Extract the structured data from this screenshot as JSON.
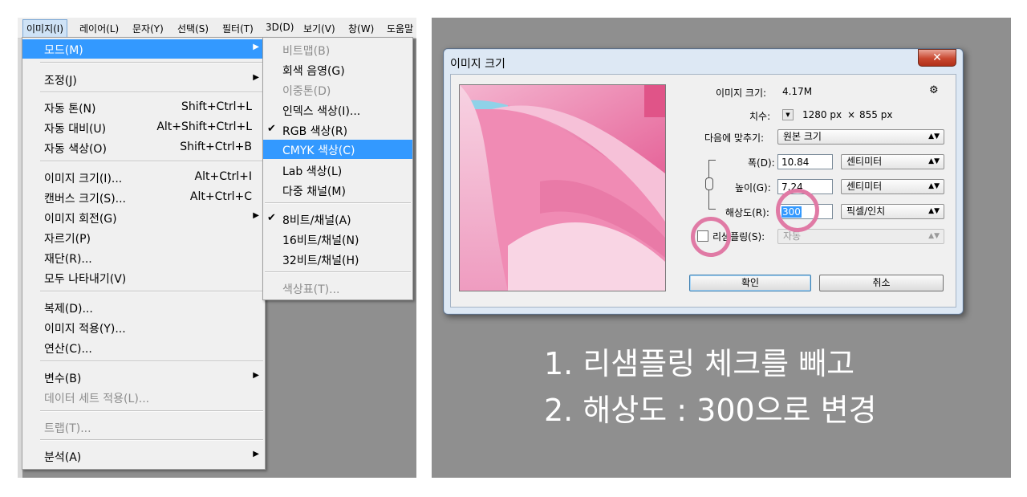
{
  "menubar": {
    "items": [
      "이미지(I)",
      "레이어(L)",
      "문자(Y)",
      "선택(S)",
      "필터(T)",
      "3D(D)",
      "보기(V)",
      "창(W)",
      "도움말"
    ]
  },
  "image_menu": {
    "items": [
      {
        "label": "모드(M)",
        "shortcut": "",
        "submenu": true
      },
      {
        "label": "조정(J)",
        "shortcut": "",
        "submenu": true
      },
      {
        "label": "자동 톤(N)",
        "shortcut": "Shift+Ctrl+L"
      },
      {
        "label": "자동 대비(U)",
        "shortcut": "Alt+Shift+Ctrl+L"
      },
      {
        "label": "자동 색상(O)",
        "shortcut": "Shift+Ctrl+B"
      },
      {
        "label": "이미지 크기(I)...",
        "shortcut": "Alt+Ctrl+I"
      },
      {
        "label": "캔버스 크기(S)...",
        "shortcut": "Alt+Ctrl+C"
      },
      {
        "label": "이미지 회전(G)",
        "shortcut": "",
        "submenu": true
      },
      {
        "label": "자르기(P)",
        "shortcut": ""
      },
      {
        "label": "재단(R)...",
        "shortcut": ""
      },
      {
        "label": "모두 나타내기(V)",
        "shortcut": ""
      },
      {
        "label": "복제(D)...",
        "shortcut": ""
      },
      {
        "label": "이미지 적용(Y)...",
        "shortcut": ""
      },
      {
        "label": "연산(C)...",
        "shortcut": ""
      },
      {
        "label": "변수(B)",
        "shortcut": "",
        "submenu": true
      },
      {
        "label": "데이터 세트 적용(L)...",
        "shortcut": "",
        "disabled": true
      },
      {
        "label": "트랩(T)...",
        "shortcut": "",
        "disabled": true
      },
      {
        "label": "분석(A)",
        "shortcut": "",
        "submenu": true
      }
    ]
  },
  "mode_submenu": {
    "items": [
      {
        "label": "비트맵(B)",
        "disabled": true
      },
      {
        "label": "회색 음영(G)"
      },
      {
        "label": "이중톤(D)",
        "disabled": true
      },
      {
        "label": "인덱스 색상(I)..."
      },
      {
        "label": "RGB 색상(R)",
        "checked": true
      },
      {
        "label": "CMYK 색상(C)",
        "highlighted": true
      },
      {
        "label": "Lab 색상(L)"
      },
      {
        "label": "다중 채널(M)"
      },
      {
        "label": "8비트/채널(A)",
        "checked": true
      },
      {
        "label": "16비트/채널(N)"
      },
      {
        "label": "32비트/채널(H)"
      },
      {
        "label": "색상표(T)...",
        "disabled": true
      }
    ]
  },
  "dialog": {
    "title": "이미지 크기",
    "close_label": "✕",
    "image_size_label": "이미지 크기:",
    "image_size_value": "4.17M",
    "gear_icon": "⚙",
    "dimensions_label": "치수:",
    "dimensions_width": "1280 px",
    "dimensions_x": "×",
    "dimensions_height": "855 px",
    "fit_to_label": "다음에 맞추기:",
    "fit_to_value": "원본 크기",
    "width_label": "폭(D):",
    "width_value": "10.84",
    "width_unit": "센티미터",
    "height_label": "높이(G):",
    "height_value": "7.24",
    "height_unit": "센티미터",
    "resolution_label": "해상도(R):",
    "resolution_value": "300",
    "resolution_unit": "픽셀/인치",
    "resample_label": "리샘플링(S):",
    "resample_value": "자동",
    "resample_checked": false,
    "ok_label": "확인",
    "cancel_label": "취소"
  },
  "captions": {
    "line1": "1. 리샘플링 체크를 빼고",
    "line2": "2. 해상도 : 300으로 변경"
  },
  "colors": {
    "highlight": "#3399ff",
    "annotation_circle": "#e07aa5",
    "background_gray": "#8f8f8f"
  }
}
